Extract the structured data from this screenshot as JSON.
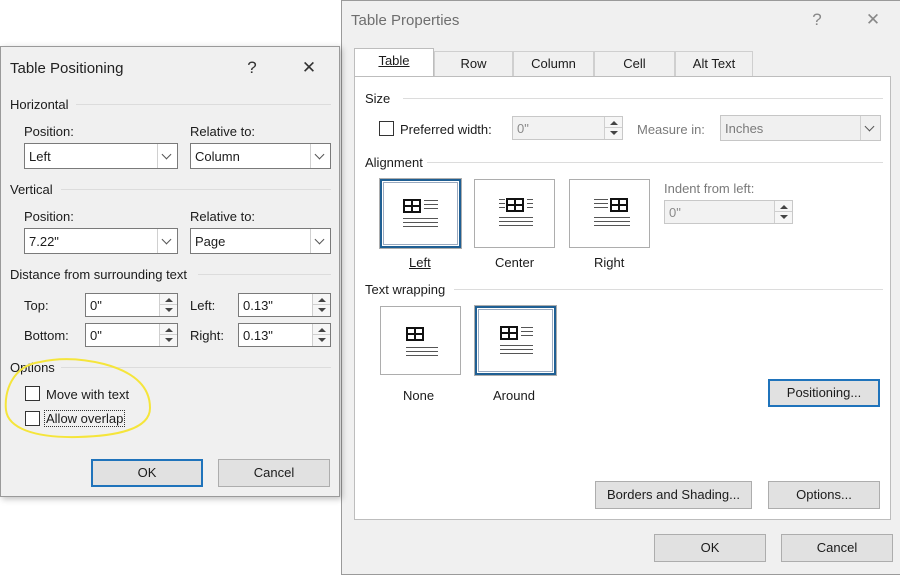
{
  "table_positioning": {
    "title": "Table Positioning",
    "help_glyph": "?",
    "close_glyph": "✕",
    "horizontal": {
      "header": "Horizontal",
      "position_label": "Position:",
      "position_value": "Left",
      "relative_label": "Relative to:",
      "relative_value": "Column"
    },
    "vertical": {
      "header": "Vertical",
      "position_label": "Position:",
      "position_value": "7.22\"",
      "relative_label": "Relative to:",
      "relative_value": "Page"
    },
    "distance": {
      "header": "Distance from surrounding text",
      "top_label": "Top:",
      "top_value": "0\"",
      "bottom_label": "Bottom:",
      "bottom_value": "0\"",
      "left_label": "Left:",
      "left_value": "0.13\"",
      "right_label": "Right:",
      "right_value": "0.13\""
    },
    "options": {
      "header": "Options",
      "move_with_text": "Move with text",
      "allow_overlap": "Allow overlap"
    },
    "ok_label": "OK",
    "cancel_label": "Cancel"
  },
  "table_properties": {
    "title": "Table Properties",
    "help_glyph": "?",
    "close_glyph": "✕",
    "tabs": [
      "Table",
      "Row",
      "Column",
      "Cell",
      "Alt Text"
    ],
    "size": {
      "header": "Size",
      "preferred_width_label": "Preferred width:",
      "preferred_width_value": "0\"",
      "measure_in_label": "Measure in:",
      "measure_in_value": "Inches"
    },
    "alignment": {
      "header": "Alignment",
      "left": "Left",
      "center": "Center",
      "right": "Right",
      "indent_label": "Indent from left:",
      "indent_value": "0\""
    },
    "text_wrapping": {
      "header": "Text wrapping",
      "none": "None",
      "around": "Around",
      "positioning_button": "Positioning..."
    },
    "borders_button": "Borders and Shading...",
    "options_button": "Options...",
    "ok_label": "OK",
    "cancel_label": "Cancel"
  },
  "colors": {
    "accent": "#1f73bb",
    "highlight_annotation": "#f5e53b"
  }
}
